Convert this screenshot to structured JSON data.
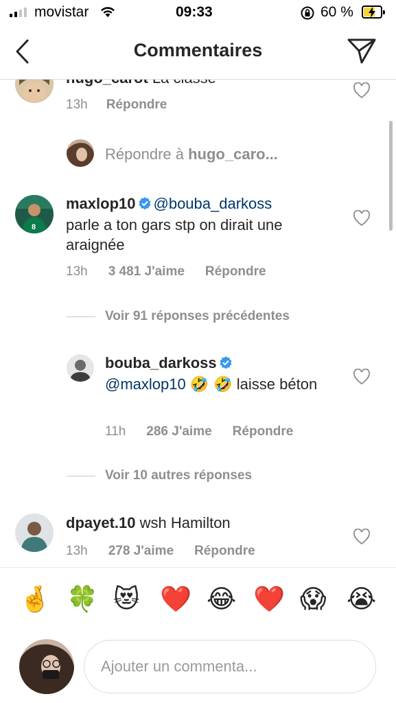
{
  "status_bar": {
    "carrier": "movistar",
    "time": "09:33",
    "battery_percent": "60 %",
    "battery_level": 0.6
  },
  "nav": {
    "title": "Commentaires",
    "back_icon": "chevron-left-icon",
    "send_icon": "paper-plane-icon"
  },
  "comments": {
    "partial": {
      "username": "hugo_carot",
      "text": "La classe",
      "time": "13h",
      "reply_label": "Répondre"
    },
    "reply_to": {
      "prefix": "Répondre à",
      "target": "hugo_caro..."
    },
    "main": {
      "username": "maxlop10",
      "mention": "@bouba_darkoss",
      "text": "parle a ton gars stp on dirait une araignée",
      "time": "13h",
      "likes": "3 481 J'aime",
      "reply_label": "Répondre"
    },
    "view_previous": "Voir 91 réponses précédentes",
    "reply": {
      "username": "bouba_darkoss",
      "mention": "@maxlop10",
      "emojis": "🤣 🤣",
      "text": "laisse béton",
      "time": "11h",
      "likes": "286 J'aime",
      "reply_label": "Répondre"
    },
    "view_more": "Voir 10 autres réponses",
    "third": {
      "username": "dpayet.10",
      "text": "wsh Hamilton",
      "time": "13h",
      "likes": "278 J'aime",
      "reply_label": "Répondre"
    }
  },
  "emoji_bar": [
    "🤞",
    "🍀",
    "😻",
    "❤️",
    "😂",
    "❤️",
    "😱",
    "😭"
  ],
  "composer": {
    "placeholder": "Ajouter un commenta..."
  },
  "colors": {
    "text": "#262626",
    "muted": "#8e8e8e",
    "mention": "#00376b",
    "verified": "#3897f0",
    "battery_fill": "#f6d53b"
  }
}
